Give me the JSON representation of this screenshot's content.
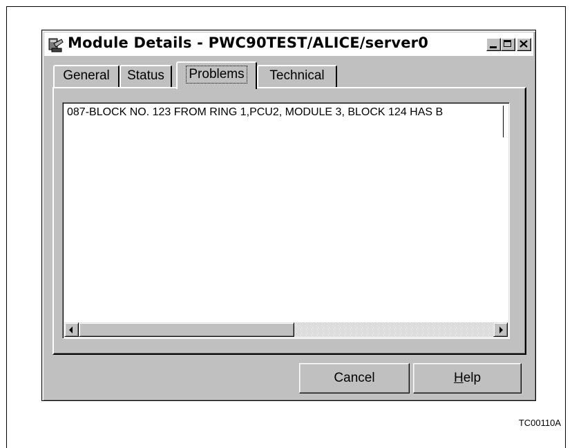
{
  "window": {
    "title": "Module Details - PWC90TEST/ALICE/server0"
  },
  "tabs": [
    {
      "label": "General"
    },
    {
      "label": "Status"
    },
    {
      "label": "Problems"
    },
    {
      "label": "Technical"
    }
  ],
  "problems": {
    "items": [
      "087-BLOCK NO. 123 FROM RING 1,PCU2, MODULE 3, BLOCK 124 HAS B"
    ]
  },
  "buttons": {
    "cancel": "Cancel",
    "help_mnemonic": "H",
    "help_rest": "elp"
  },
  "figure_id": "TC00110A",
  "icons": {
    "app": "module-app-icon",
    "minimize": "minimize-icon",
    "maximize": "maximize-icon",
    "close": "close-icon",
    "scroll_left": "arrow-left-icon",
    "scroll_right": "arrow-right-icon"
  }
}
